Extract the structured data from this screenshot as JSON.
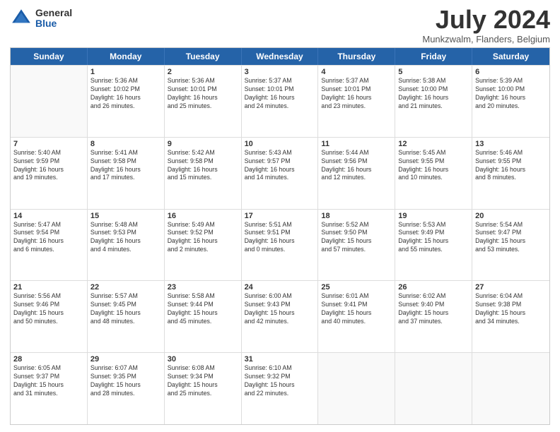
{
  "logo": {
    "general": "General",
    "blue": "Blue"
  },
  "title": "July 2024",
  "location": "Munkzwalm, Flanders, Belgium",
  "days_of_week": [
    "Sunday",
    "Monday",
    "Tuesday",
    "Wednesday",
    "Thursday",
    "Friday",
    "Saturday"
  ],
  "weeks": [
    [
      {
        "day": "",
        "empty": true,
        "info": ""
      },
      {
        "day": "1",
        "info": "Sunrise: 5:36 AM\nSunset: 10:02 PM\nDaylight: 16 hours\nand 26 minutes."
      },
      {
        "day": "2",
        "info": "Sunrise: 5:36 AM\nSunset: 10:01 PM\nDaylight: 16 hours\nand 25 minutes."
      },
      {
        "day": "3",
        "info": "Sunrise: 5:37 AM\nSunset: 10:01 PM\nDaylight: 16 hours\nand 24 minutes."
      },
      {
        "day": "4",
        "info": "Sunrise: 5:37 AM\nSunset: 10:01 PM\nDaylight: 16 hours\nand 23 minutes."
      },
      {
        "day": "5",
        "info": "Sunrise: 5:38 AM\nSunset: 10:00 PM\nDaylight: 16 hours\nand 21 minutes."
      },
      {
        "day": "6",
        "info": "Sunrise: 5:39 AM\nSunset: 10:00 PM\nDaylight: 16 hours\nand 20 minutes."
      }
    ],
    [
      {
        "day": "7",
        "info": "Sunrise: 5:40 AM\nSunset: 9:59 PM\nDaylight: 16 hours\nand 19 minutes."
      },
      {
        "day": "8",
        "info": "Sunrise: 5:41 AM\nSunset: 9:58 PM\nDaylight: 16 hours\nand 17 minutes."
      },
      {
        "day": "9",
        "info": "Sunrise: 5:42 AM\nSunset: 9:58 PM\nDaylight: 16 hours\nand 15 minutes."
      },
      {
        "day": "10",
        "info": "Sunrise: 5:43 AM\nSunset: 9:57 PM\nDaylight: 16 hours\nand 14 minutes."
      },
      {
        "day": "11",
        "info": "Sunrise: 5:44 AM\nSunset: 9:56 PM\nDaylight: 16 hours\nand 12 minutes."
      },
      {
        "day": "12",
        "info": "Sunrise: 5:45 AM\nSunset: 9:55 PM\nDaylight: 16 hours\nand 10 minutes."
      },
      {
        "day": "13",
        "info": "Sunrise: 5:46 AM\nSunset: 9:55 PM\nDaylight: 16 hours\nand 8 minutes."
      }
    ],
    [
      {
        "day": "14",
        "info": "Sunrise: 5:47 AM\nSunset: 9:54 PM\nDaylight: 16 hours\nand 6 minutes."
      },
      {
        "day": "15",
        "info": "Sunrise: 5:48 AM\nSunset: 9:53 PM\nDaylight: 16 hours\nand 4 minutes."
      },
      {
        "day": "16",
        "info": "Sunrise: 5:49 AM\nSunset: 9:52 PM\nDaylight: 16 hours\nand 2 minutes."
      },
      {
        "day": "17",
        "info": "Sunrise: 5:51 AM\nSunset: 9:51 PM\nDaylight: 16 hours\nand 0 minutes."
      },
      {
        "day": "18",
        "info": "Sunrise: 5:52 AM\nSunset: 9:50 PM\nDaylight: 15 hours\nand 57 minutes."
      },
      {
        "day": "19",
        "info": "Sunrise: 5:53 AM\nSunset: 9:49 PM\nDaylight: 15 hours\nand 55 minutes."
      },
      {
        "day": "20",
        "info": "Sunrise: 5:54 AM\nSunset: 9:47 PM\nDaylight: 15 hours\nand 53 minutes."
      }
    ],
    [
      {
        "day": "21",
        "info": "Sunrise: 5:56 AM\nSunset: 9:46 PM\nDaylight: 15 hours\nand 50 minutes."
      },
      {
        "day": "22",
        "info": "Sunrise: 5:57 AM\nSunset: 9:45 PM\nDaylight: 15 hours\nand 48 minutes."
      },
      {
        "day": "23",
        "info": "Sunrise: 5:58 AM\nSunset: 9:44 PM\nDaylight: 15 hours\nand 45 minutes."
      },
      {
        "day": "24",
        "info": "Sunrise: 6:00 AM\nSunset: 9:43 PM\nDaylight: 15 hours\nand 42 minutes."
      },
      {
        "day": "25",
        "info": "Sunrise: 6:01 AM\nSunset: 9:41 PM\nDaylight: 15 hours\nand 40 minutes."
      },
      {
        "day": "26",
        "info": "Sunrise: 6:02 AM\nSunset: 9:40 PM\nDaylight: 15 hours\nand 37 minutes."
      },
      {
        "day": "27",
        "info": "Sunrise: 6:04 AM\nSunset: 9:38 PM\nDaylight: 15 hours\nand 34 minutes."
      }
    ],
    [
      {
        "day": "28",
        "info": "Sunrise: 6:05 AM\nSunset: 9:37 PM\nDaylight: 15 hours\nand 31 minutes."
      },
      {
        "day": "29",
        "info": "Sunrise: 6:07 AM\nSunset: 9:35 PM\nDaylight: 15 hours\nand 28 minutes."
      },
      {
        "day": "30",
        "info": "Sunrise: 6:08 AM\nSunset: 9:34 PM\nDaylight: 15 hours\nand 25 minutes."
      },
      {
        "day": "31",
        "info": "Sunrise: 6:10 AM\nSunset: 9:32 PM\nDaylight: 15 hours\nand 22 minutes."
      },
      {
        "day": "",
        "empty": true,
        "info": ""
      },
      {
        "day": "",
        "empty": true,
        "info": ""
      },
      {
        "day": "",
        "empty": true,
        "info": ""
      }
    ]
  ]
}
